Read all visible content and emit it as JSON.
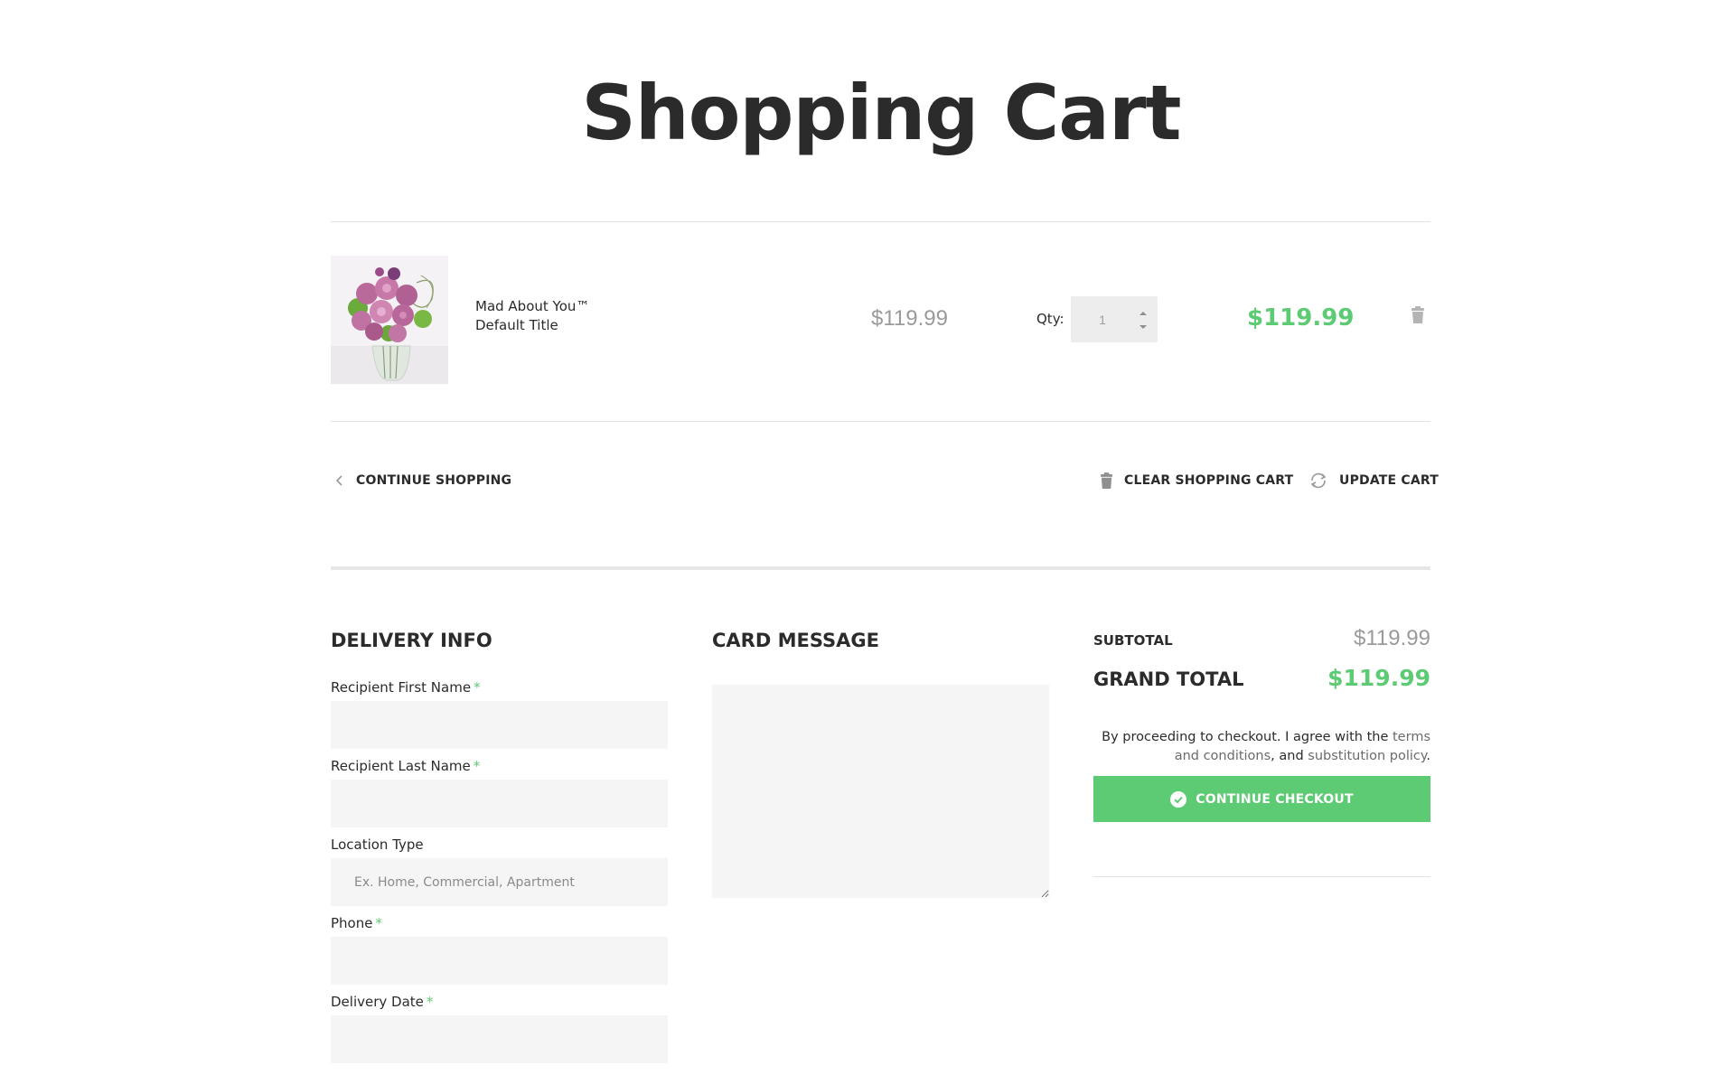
{
  "page": {
    "title": "Shopping Cart"
  },
  "cart": {
    "items": [
      {
        "name": "Mad About You™",
        "variant": "Default Title",
        "unit_price": "$119.99",
        "qty_label": "Qty:",
        "qty": "1",
        "line_total": "$119.99",
        "image_icon": "flower-bouquet-image",
        "remove_icon": "trash-icon"
      }
    ]
  },
  "actions": {
    "continue_shopping": "CONTINUE SHOPPING",
    "clear_cart": "CLEAR SHOPPING CART",
    "update_cart": "UPDATE CART"
  },
  "delivery": {
    "heading": "DELIVERY INFO",
    "fields": {
      "first_name": {
        "label": "Recipient First Name",
        "required": "*"
      },
      "last_name": {
        "label": "Recipient Last Name",
        "required": "*"
      },
      "location_type": {
        "label": "Location Type",
        "placeholder": "Ex. Home, Commercial, Apartment"
      },
      "phone": {
        "label": "Phone",
        "required": "*"
      },
      "delivery_date": {
        "label": "Delivery Date",
        "required": "*"
      }
    }
  },
  "card_message": {
    "heading": "CARD MESSAGE"
  },
  "summary": {
    "subtotal_label": "SUBTOTAL",
    "subtotal_value": "$119.99",
    "grand_total_label": "GRAND TOTAL",
    "grand_total_value": "$119.99",
    "agree_prefix": "By proceeding to checkout. I agree with the",
    "terms_link": "terms and conditions",
    "agree_mid": ", and",
    "substitution_link": "substitution policy",
    "agree_suffix": ".",
    "checkout_button": "CONTINUE CHECKOUT"
  },
  "colors": {
    "accent_green": "#5ccb74",
    "text_dark": "#2b2b2b",
    "muted_gray": "#9a9a9a",
    "field_bg": "#f5f5f6"
  }
}
